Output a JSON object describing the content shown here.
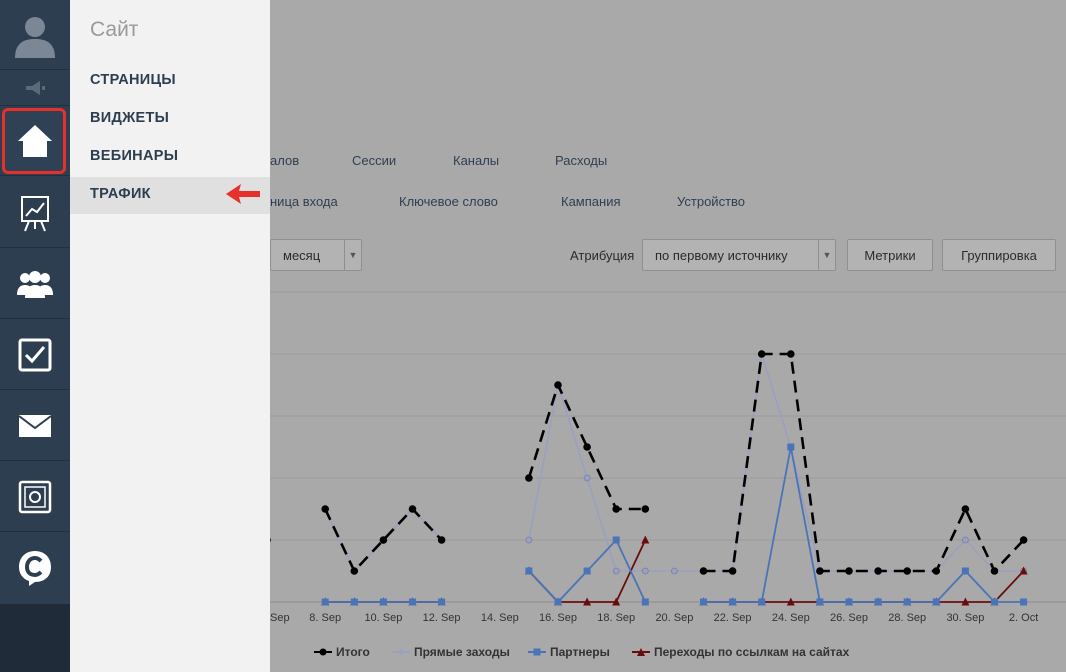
{
  "sidebar_panel": {
    "title": "Сайт",
    "items": [
      {
        "label": "СТРАНИЦЫ"
      },
      {
        "label": "ВИДЖЕТЫ"
      },
      {
        "label": "ВЕБИНАРЫ"
      },
      {
        "label": "ТРАФИК"
      }
    ]
  },
  "tabs_row1": [
    "алов",
    "Сессии",
    "Каналы",
    "Расходы"
  ],
  "tabs_row2": [
    "ница входа",
    "Ключевое слово",
    "Кампания",
    "Устройство"
  ],
  "controls": {
    "period_value": "месяц",
    "attribution_label": "Атрибуция",
    "attribution_value": "по первому источнику",
    "metrics_button": "Метрики",
    "grouping_button": "Группировка"
  },
  "colors": {
    "total": "#000000",
    "direct": "#9aa0c0",
    "partners": "#4a74b8",
    "referrals": "#6b0c0c",
    "accent": "#e8302b"
  },
  "chart_data": {
    "type": "line",
    "x": [
      "7. Sep",
      "8. Sep",
      "9. Sep",
      "10. Sep",
      "11. Sep",
      "12. Sep",
      "13. Sep",
      "14. Sep",
      "15. Sep",
      "16. Sep",
      "17. Sep",
      "18. Sep",
      "19. Sep",
      "20. Sep",
      "21. Sep",
      "22. Sep",
      "23. Sep",
      "24. Sep",
      "25. Sep",
      "26. Sep",
      "27. Sep",
      "28. Sep",
      "29. Sep",
      "30. Sep",
      "1. Oct",
      "2. Oct",
      "3. Oct"
    ],
    "xtick_labels": [
      "Sep",
      "8. Sep",
      "10. Sep",
      "12. Sep",
      "14. Sep",
      "16. Sep",
      "18. Sep",
      "20. Sep",
      "22. Sep",
      "24. Sep",
      "26. Sep",
      "28. Sep",
      "30. Sep",
      "2. Oct"
    ],
    "series": [
      {
        "name": "Итого",
        "values": [
          1,
          null,
          2,
          0,
          1,
          2,
          1,
          null,
          null,
          3,
          6,
          4,
          2,
          2,
          null,
          0,
          0,
          7,
          7,
          0,
          0,
          0,
          0,
          0,
          2,
          0,
          1
        ]
      },
      {
        "name": "Прямые заходы",
        "values": [
          1,
          null,
          2,
          0,
          1,
          2,
          1,
          null,
          null,
          1,
          6,
          3,
          0,
          0,
          0,
          0,
          0,
          7,
          4,
          0,
          0,
          0,
          0,
          0,
          1,
          0,
          0
        ]
      },
      {
        "name": "Партнеры",
        "values": [
          null,
          null,
          -1,
          -1,
          -1,
          -1,
          -1,
          null,
          null,
          0,
          -1,
          0,
          1,
          -1,
          null,
          -1,
          -1,
          -1,
          4,
          -1,
          -1,
          -1,
          -1,
          -1,
          0,
          -1,
          -1
        ]
      },
      {
        "name": "Переходы по ссылкам на сайтах",
        "values": [
          null,
          null,
          -1,
          -1,
          -1,
          -1,
          -1,
          null,
          null,
          0,
          -1,
          -1,
          -1,
          1,
          null,
          -1,
          -1,
          -1,
          -1,
          -1,
          -1,
          -1,
          -1,
          -1,
          -1,
          -1,
          0
        ]
      }
    ]
  }
}
